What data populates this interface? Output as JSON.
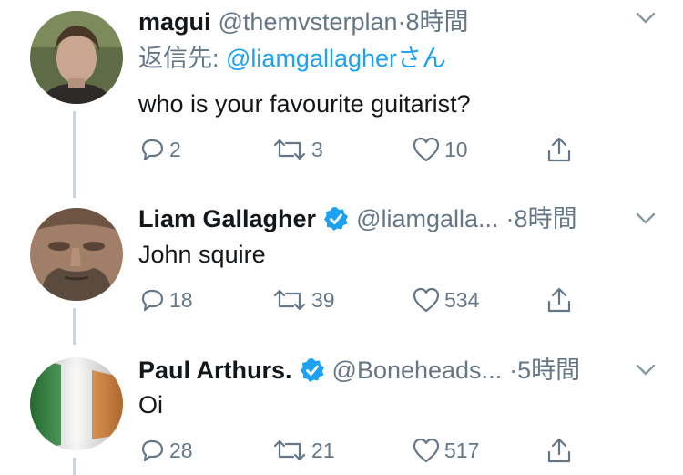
{
  "colors": {
    "accent": "#1da1f2",
    "secondary_text": "#657786",
    "primary_text": "#14171a",
    "thread_line": "#ccd6dd"
  },
  "tweets": [
    {
      "name": "magui",
      "handle": "@themvsterplan",
      "separator": "·",
      "time": "8時間",
      "verified": false,
      "reply_prefix": "返信先: ",
      "reply_handle": "@liamgallagher",
      "reply_suffix": "さん",
      "text": "who is your favourite guitarist?",
      "replies": "2",
      "retweets": "3",
      "likes": "10",
      "avatar_icon": "profile-photo"
    },
    {
      "name": "Liam Gallagher",
      "handle": "@liamgalla...",
      "separator": "·",
      "time": "8時間",
      "verified": true,
      "text": "John squire",
      "replies": "18",
      "retweets": "39",
      "likes": "534",
      "avatar_icon": "profile-photo"
    },
    {
      "name": "Paul Arthurs.",
      "handle": "@Boneheads...",
      "separator": "·",
      "time": "5時間",
      "verified": true,
      "text": "Oi",
      "replies": "28",
      "retweets": "21",
      "likes": "517",
      "avatar_icon": "irish-flag"
    }
  ],
  "icons": {
    "reply": "reply-icon",
    "retweet": "retweet-icon",
    "like": "heart-icon",
    "share": "share-icon",
    "menu": "chevron-down-icon",
    "verified": "verified-badge-icon"
  }
}
